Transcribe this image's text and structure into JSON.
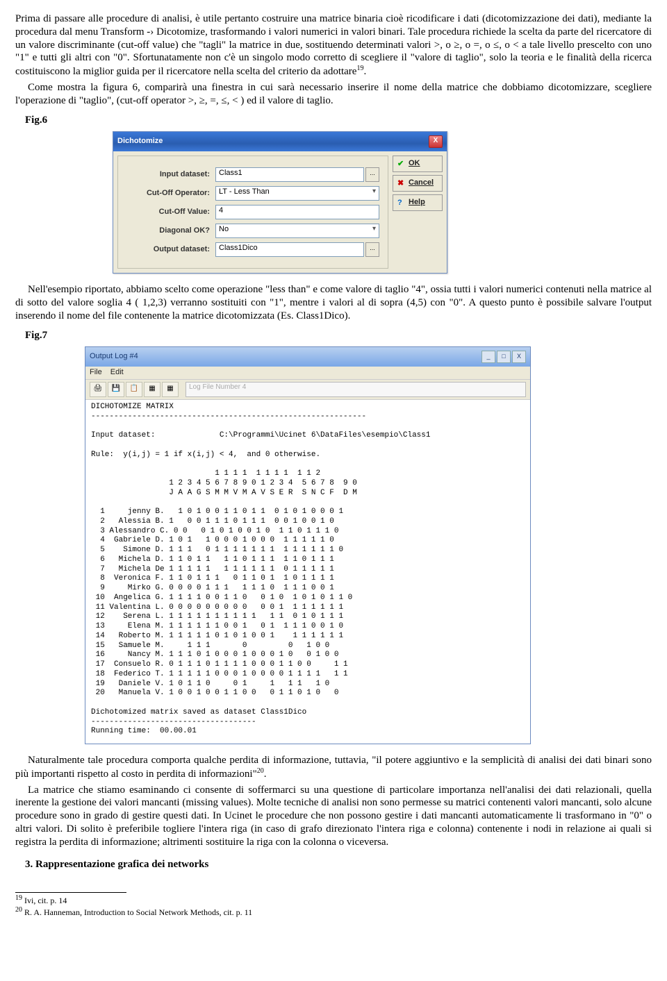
{
  "para1": "Prima di passare alle procedure di analisi, è utile pertanto costruire una matrice binaria cioè ricodificare i dati (dicotomizzazione dei dati), mediante la procedura dal menu Transform -› Dicotomize, trasformando i valori numerici in valori binari. Tale procedura richiede la scelta da parte del ricercatore di un valore discriminante (cut-off value) che \"tagli\" la matrice in due, sostituendo determinati valori >, o ≥, o =, o ≤, o < a tale livello prescelto con uno \"1\" e tutti gli altri con \"0\". Sfortunatamente non c'è un singolo modo corretto di scegliere il \"valore di taglio\", solo la teoria e le finalità della ricerca costituiscono la miglior guida per il ricercatore nella scelta del criterio da adottare",
  "para1_fn": "19",
  "para1_tail": ".",
  "para2": "Come mostra la figura 6, comparirà una finestra in cui sarà necessario inserire il nome della matrice che dobbiamo dicotomizzare, scegliere l'operazione di \"taglio\", (cut-off operator >, ≥, =, ≤, < ) ed il valore di taglio.",
  "fig6": "Fig.6",
  "dialog": {
    "title": "Dichotomize",
    "close": "X",
    "rows": {
      "input_label": "Input dataset:",
      "input_value": "Class1",
      "op_label": "Cut-Off Operator:",
      "op_value": "LT - Less Than",
      "val_label": "Cut-Off Value:",
      "val_value": "4",
      "diag_label": "Diagonal OK?",
      "diag_value": "No",
      "out_label": "Output dataset:",
      "out_value": "Class1Dico"
    },
    "btn_ok": "OK",
    "btn_cancel": "Cancel",
    "btn_help": "Help",
    "dots": "..."
  },
  "para3": "Nell'esempio riportato, abbiamo scelto come operazione \"less than\" e come valore di taglio \"4\", ossia tutti i valori numerici contenuti nella matrice al di sotto del valore soglia 4 ( 1,2,3) verranno sostituiti con \"1\", mentre i valori al di sopra (4,5) con \"0\". A questo punto è possibile salvare l'output inserendo il nome del file contenente la matrice dicotomizzata (Es. Class1Dico).",
  "fig7": "Fig.7",
  "out": {
    "title": "Output Log #4",
    "min": "_",
    "max": "□",
    "close": "X",
    "menu_file": "File",
    "menu_edit": "Edit",
    "tbtn1": "🖨",
    "tbtn2": "💾",
    "tbtn3": "📋",
    "tbtn4": "▦",
    "tbtn5": "▦",
    "logfn": "Log File Number 4",
    "body": "DICHOTOMIZE MATRIX\n------------------------------------------------------------\n\nInput dataset:              C:\\Programmi\\Ucinet 6\\DataFiles\\esempio\\Class1\n\nRule:  y(i,j) = 1 if x(i,j) < 4,  and 0 otherwise.\n\n                           1 1 1 1  1 1 1 1  1 1 2\n                 1 2 3 4 5 6 7 8 9 0 1 2 3 4  5 6 7 8  9 0\n                 J A A G S M M V M A V S E R  S N C F  D M\n\n  1     jenny B.   1 0 1 0 0 1 1 0 1 1  0 1 0 1 0 0 0 1\n  2   Alessia B. 1   0 0 1 1 1 0 1 1 1  0 0 1 0 0 1 0\n  3 Alessandro C. 0 0   0 1 0 1 0 0 1 0  1 1 0 1 1 1 0\n  4  Gabriele D. 1 0 1   1 0 0 0 1 0 0 0  1 1 1 1 1 0\n  5    Simone D. 1 1 1   0 1 1 1 1 1 1 1  1 1 1 1 1 1 0\n  6   Michela D. 1 1 0 1 1   1 1 0 1 1 1  1 1 0 1 1 1\n  7   Michela De 1 1 1 1 1   1 1 1 1 1 1  0 1 1 1 1 1\n  8  Veronica F. 1 1 0 1 1 1   0 1 1 0 1  1 0 1 1 1 1\n  9     Mirko G. 0 0 0 0 1 1 1   1 1 1 0  1 1 1 0 0 1\n 10  Angelica G. 1 1 1 1 0 0 1 1 0   0 1 0  1 0 1 0 1 1 0\n 11 Valentina L. 0 0 0 0 0 0 0 0 0   0 0 1  1 1 1 1 1 1\n 12    Serena L. 1 1 1 1 1 1 1 1 1 1   1 1  0 1 0 1 1 1\n 13     Elena M. 1 1 1 1 1 1 0 0 1   0 1  1 1 1 0 0 1 0\n 14   Roberto M. 1 1 1 1 1 0 1 0 1 0 0 1    1 1 1 1 1 1\n 15   Samuele M.     1 1 1       0         0   1 0 0\n 16     Nancy M. 1 1 1 0 1 0 0 0 1 0 0 0 1 0   0 1 0 0\n 17  Consuelo R. 0 1 1 1 0 1 1 1 1 0 0 0 1 1 0 0     1 1\n 18  Federico T. 1 1 1 1 1 0 0 0 1 0 0 0 0 1 1 1 1   1 1\n 19   Daniele V. 1 0 1 1 0     0 1     1   1 1   1 0\n 20   Manuela V. 1 0 0 1 0 0 1 1 0 0   0 1 1 0 1 0   0\n\nDichotomized matrix saved as dataset Class1Dico\n------------------------------------\nRunning time:  00.00.01"
  },
  "para4a": "Naturalmente tale procedura comporta qualche perdita di informazione, tuttavia, \"il potere aggiuntivo e la semplicità di analisi dei dati binari sono più importanti rispetto al costo in perdita di informazioni\"",
  "para4_fn": "20",
  "para4_tail": ".",
  "para5": "La matrice che stiamo esaminando ci consente di soffermarci su una questione di particolare importanza nell'analisi dei dati relazionali, quella inerente la gestione dei valori mancanti (missing values). Molte tecniche di analisi non sono permesse su matrici contenenti valori mancanti, solo alcune procedure sono in grado di gestire questi dati. In Ucinet le procedure che non possono gestire i dati mancanti automaticamente li trasformano in \"0\" o altri valori. Di solito è preferibile togliere l'intera riga (in caso di grafo direzionato l'intera riga e colonna) contenente i nodi in relazione ai quali si registra la perdita di informazione; altrimenti sostituire la riga con la colonna o viceversa.",
  "section3": "3. Rappresentazione grafica dei networks",
  "fn19": " Ivi, cit. p. 14",
  "fn19num": "19",
  "fn20": " R. A. Hanneman, Introduction to Social Network Methods, cit. p. 11",
  "fn20num": "20"
}
